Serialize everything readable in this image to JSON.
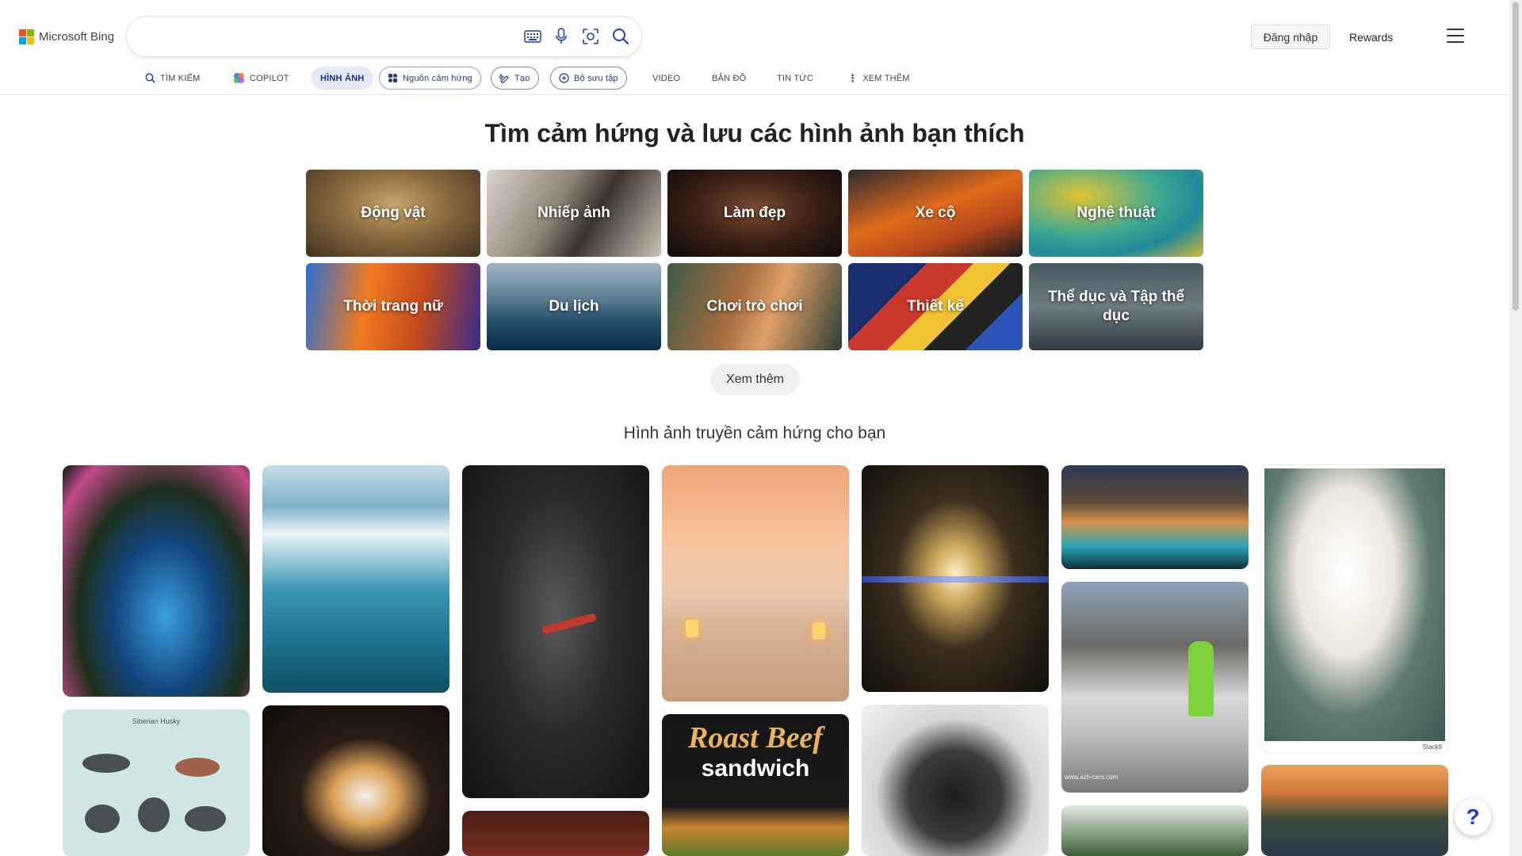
{
  "header": {
    "brand": "Microsoft Bing",
    "search_value": "",
    "signin_label": "Đăng nhập",
    "rewards_label": "Rewards"
  },
  "nav": {
    "tabs": [
      {
        "label": "TÌM KIẾM",
        "icon": "search-icon"
      },
      {
        "label": "COPILOT",
        "icon": "copilot-icon"
      },
      {
        "label": "HÌNH ẢNH",
        "active": true
      },
      {
        "label": "Nguồn cảm hứng",
        "icon": "inspiration-icon"
      },
      {
        "label": "Tạo",
        "icon": "create-icon"
      },
      {
        "label": "Bộ sưu tập",
        "icon": "collection-icon"
      },
      {
        "label": "VIDEO"
      },
      {
        "label": "BẢN ĐỒ"
      },
      {
        "label": "TIN TỨC"
      },
      {
        "label": "XEM THÊM",
        "icon": "more-dots-icon"
      }
    ]
  },
  "main": {
    "headline": "Tìm cảm hứng và lưu các hình ảnh bạn thích",
    "categories": [
      "Động vật",
      "Nhiếp ảnh",
      "Làm đẹp",
      "Xe cộ",
      "Nghệ thuật",
      "Thời trang nữ",
      "Du lịch",
      "Chơi trò chơi",
      "Thiết kế",
      "Thể dục và Tập thể dục"
    ],
    "see_more_label": "Xem thêm",
    "inspiration_heading": "Hình ảnh truyền cảm hứng cho bạn",
    "tile_texts": {
      "husky_chart": "Siberian Husky",
      "roast_line1": "Roast Beef",
      "roast_line2": "sandwich",
      "car_watermark": "www.azh-cars.com",
      "stack_watermark": "Stack9"
    }
  },
  "help_label": "?",
  "colors": {
    "accent": "#1a2a8a",
    "active_tab_bg": "#e6eaf8"
  }
}
